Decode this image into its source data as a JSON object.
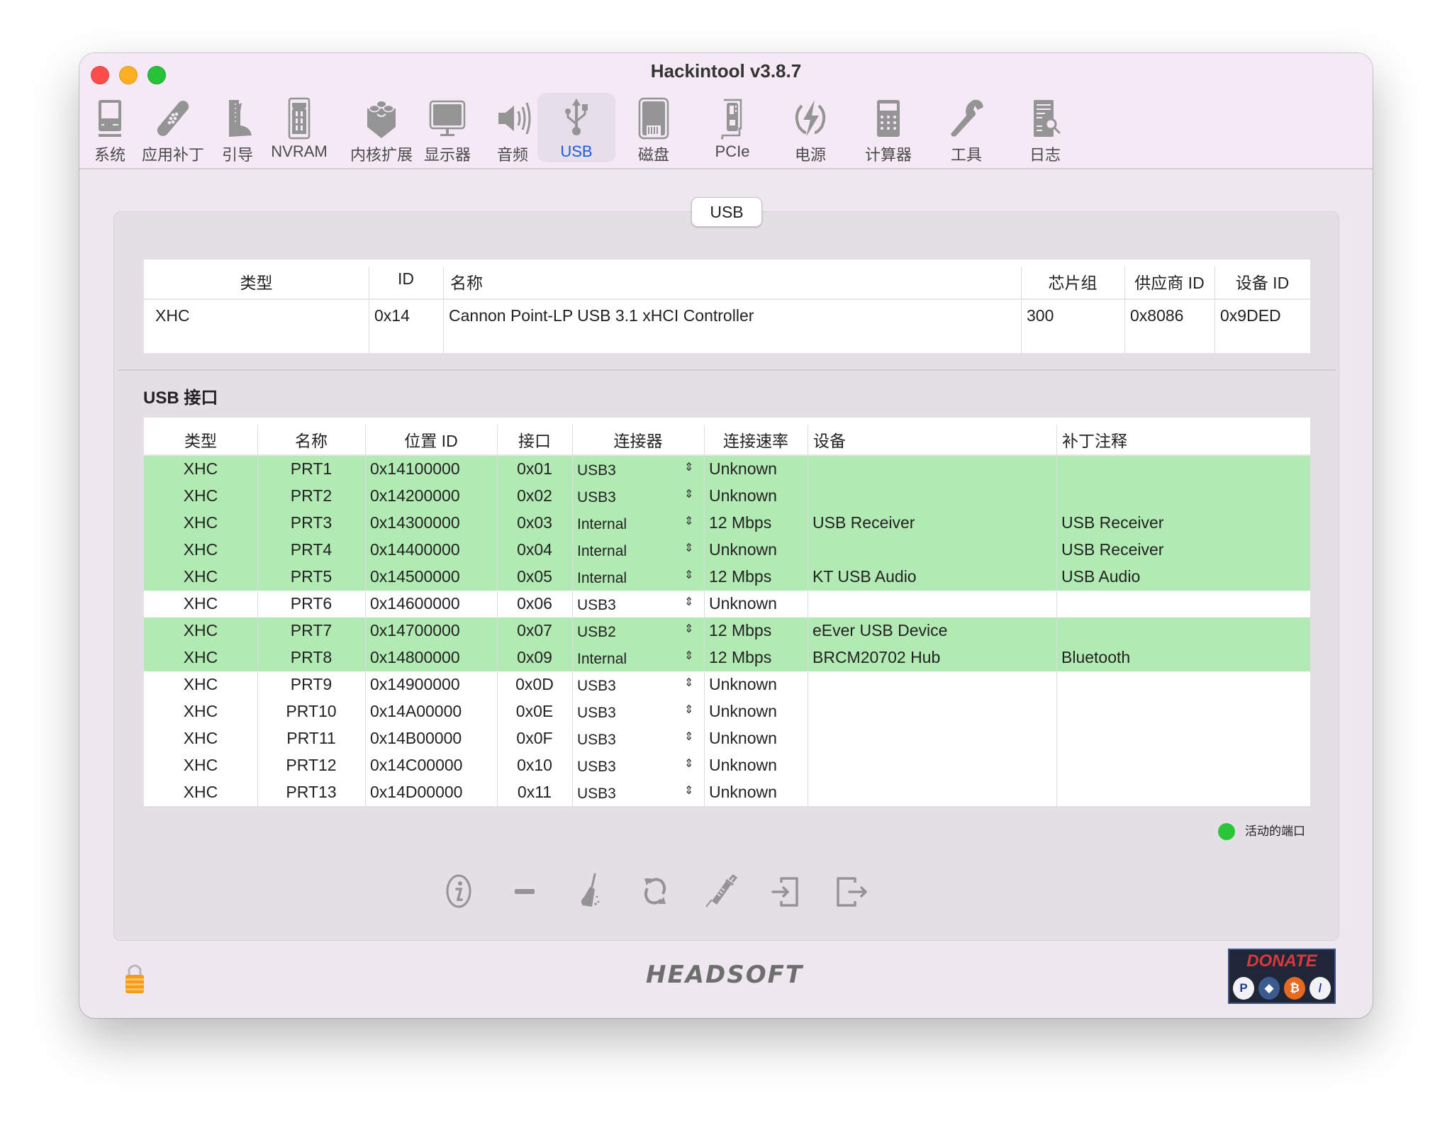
{
  "window": {
    "title": "Hackintool v3.8.7"
  },
  "toolbar": {
    "items": [
      {
        "label": "系统",
        "icon": "system-icon"
      },
      {
        "label": "应用补丁",
        "icon": "patch-bandage-icon"
      },
      {
        "label": "引导",
        "icon": "boot-icon"
      },
      {
        "label": "NVRAM",
        "icon": "nvram-icon"
      },
      {
        "label": "内核扩展",
        "icon": "kext-lego-icon"
      },
      {
        "label": "显示器",
        "icon": "display-icon"
      },
      {
        "label": "音频",
        "icon": "speaker-icon"
      },
      {
        "label": "USB",
        "icon": "usb-icon",
        "active": true
      },
      {
        "label": "磁盘",
        "icon": "disk-icon"
      },
      {
        "label": "PCIe",
        "icon": "pcie-icon"
      },
      {
        "label": "电源",
        "icon": "power-icon"
      },
      {
        "label": "计算器",
        "icon": "calculator-icon"
      },
      {
        "label": "工具",
        "icon": "wrench-icon"
      },
      {
        "label": "日志",
        "icon": "log-icon"
      }
    ],
    "active_color": "#1b5bdc"
  },
  "group": {
    "tab_label": "USB"
  },
  "controllers": {
    "headers": [
      "类型",
      "ID",
      "名称",
      "芯片组",
      "供应商 ID",
      "设备 ID"
    ],
    "rows": [
      [
        "XHC",
        "0x14",
        "Cannon Point-LP USB 3.1 xHCI Controller",
        "300",
        "0x8086",
        "0x9DED"
      ]
    ]
  },
  "ports": {
    "section_label": "USB 接口",
    "headers": [
      "类型",
      "名称",
      "位置 ID",
      "接口",
      "连接器",
      "连接速率",
      "设备",
      "补丁注释"
    ],
    "active_color": "#b2eab3",
    "rows": [
      {
        "type": "XHC",
        "name": "PRT1",
        "location": "0x14100000",
        "port": "0x01",
        "connector": "USB3",
        "speed": "Unknown",
        "device": "",
        "comment": "",
        "active": true
      },
      {
        "type": "XHC",
        "name": "PRT2",
        "location": "0x14200000",
        "port": "0x02",
        "connector": "USB3",
        "speed": "Unknown",
        "device": "",
        "comment": "",
        "active": true
      },
      {
        "type": "XHC",
        "name": "PRT3",
        "location": "0x14300000",
        "port": "0x03",
        "connector": "Internal",
        "speed": "12 Mbps",
        "device": "USB Receiver",
        "comment": "USB Receiver",
        "active": true
      },
      {
        "type": "XHC",
        "name": "PRT4",
        "location": "0x14400000",
        "port": "0x04",
        "connector": "Internal",
        "speed": "Unknown",
        "device": "",
        "comment": "USB Receiver",
        "active": true
      },
      {
        "type": "XHC",
        "name": "PRT5",
        "location": "0x14500000",
        "port": "0x05",
        "connector": "Internal",
        "speed": "12 Mbps",
        "device": "KT USB Audio",
        "comment": "USB Audio",
        "active": true
      },
      {
        "type": "XHC",
        "name": "PRT6",
        "location": "0x14600000",
        "port": "0x06",
        "connector": "USB3",
        "speed": "Unknown",
        "device": "",
        "comment": "",
        "active": false
      },
      {
        "type": "XHC",
        "name": "PRT7",
        "location": "0x14700000",
        "port": "0x07",
        "connector": "USB2",
        "speed": "12 Mbps",
        "device": "eEver USB Device",
        "comment": "",
        "active": true
      },
      {
        "type": "XHC",
        "name": "PRT8",
        "location": "0x14800000",
        "port": "0x09",
        "connector": "Internal",
        "speed": "12 Mbps",
        "device": "BRCM20702 Hub",
        "comment": "Bluetooth",
        "active": true
      },
      {
        "type": "XHC",
        "name": "PRT9",
        "location": "0x14900000",
        "port": "0x0D",
        "connector": "USB3",
        "speed": "Unknown",
        "device": "",
        "comment": "",
        "active": false
      },
      {
        "type": "XHC",
        "name": "PRT10",
        "location": "0x14A00000",
        "port": "0x0E",
        "connector": "USB3",
        "speed": "Unknown",
        "device": "",
        "comment": "",
        "active": false
      },
      {
        "type": "XHC",
        "name": "PRT11",
        "location": "0x14B00000",
        "port": "0x0F",
        "connector": "USB3",
        "speed": "Unknown",
        "device": "",
        "comment": "",
        "active": false
      },
      {
        "type": "XHC",
        "name": "PRT12",
        "location": "0x14C00000",
        "port": "0x10",
        "connector": "USB3",
        "speed": "Unknown",
        "device": "",
        "comment": "",
        "active": false
      },
      {
        "type": "XHC",
        "name": "PRT13",
        "location": "0x14D00000",
        "port": "0x11",
        "connector": "USB3",
        "speed": "Unknown",
        "device": "",
        "comment": "",
        "active": false
      }
    ]
  },
  "legend": {
    "label": "活动的端口",
    "color": "#2bc637"
  },
  "actions": [
    {
      "name": "info",
      "icon": "info-icon"
    },
    {
      "name": "remove",
      "icon": "minus-icon"
    },
    {
      "name": "clear",
      "icon": "broom-icon"
    },
    {
      "name": "refresh",
      "icon": "refresh-icon"
    },
    {
      "name": "inject",
      "icon": "syringe-icon"
    },
    {
      "name": "import",
      "icon": "import-icon"
    },
    {
      "name": "export",
      "icon": "export-icon"
    }
  ],
  "footer": {
    "brand": "HEADSOFT",
    "donate_label": "DONATE",
    "donate_coins": [
      "paypal",
      "ethereum",
      "bitcoin",
      "ravencoin"
    ]
  }
}
